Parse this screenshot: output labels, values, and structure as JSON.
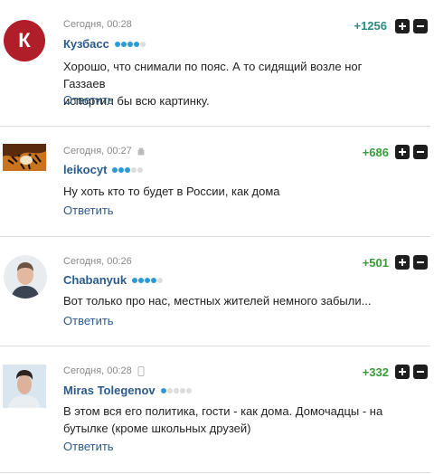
{
  "reply_label": "Ответить",
  "comments": [
    {
      "time": "Сегодня, 00:28",
      "user": "Кузбасс",
      "rating_filled": 4,
      "score": "+1256",
      "avatar_letter": "К",
      "text_lines": [
        "Хорошо, что снимали по пояс. А то сидящий возле ног Газзаев",
        "испортил бы всю картинку."
      ]
    },
    {
      "time": "Сегодня, 00:27",
      "user": "leikocyt",
      "rating_filled": 3,
      "score": "+686",
      "device": "android-icon",
      "text_lines": [
        "Ну хоть кто то будет в России, как дома"
      ]
    },
    {
      "time": "Сегодня, 00:26",
      "user": "Chabanyuk",
      "rating_filled": 4,
      "score": "+501",
      "text_lines": [
        "Вот только про нас, местных жителей немного забыли..."
      ]
    },
    {
      "time": "Сегодня, 00:28",
      "user": "Miras Tolegenov",
      "rating_filled": 1,
      "score": "+332",
      "device": "mobile-phone-icon",
      "text_lines": [
        "В этом вся его политика, гости - как дома. Домочадцы - на",
        "бутылке (кроме школьных друзей)"
      ]
    }
  ],
  "colors": {
    "link": "#2a5b8c",
    "score_top": "#2b8c82",
    "score": "#3a9a3a",
    "rating_on": "#2b9bd7",
    "avatar_bg": "#b01e2a"
  }
}
